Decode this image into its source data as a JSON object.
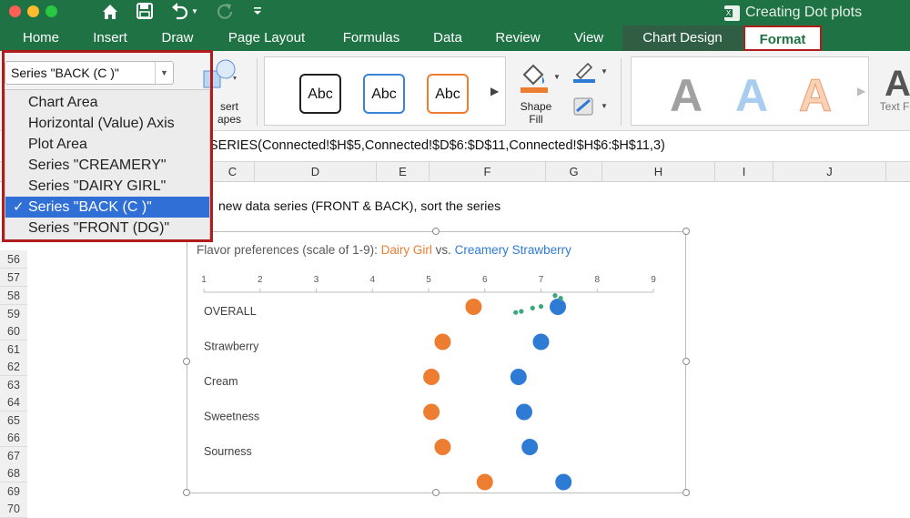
{
  "titlebar": {
    "doc_title": "Creating Dot plots",
    "colors": {
      "close": "#fe5f57",
      "minimize": "#febc2e",
      "maximize": "#28c840"
    },
    "icons": [
      "home-icon",
      "save-icon",
      "undo-icon",
      "redo-icon",
      "customize-icon"
    ]
  },
  "tabs": [
    "Home",
    "Insert",
    "Draw",
    "Page Layout",
    "Formulas",
    "Data",
    "Review",
    "View",
    "Chart Design",
    "Format"
  ],
  "ribbon": {
    "insert_shapes_label": "Insert Shapes",
    "insert_shapes_top": "sert",
    "insert_shapes_bottom": "apes",
    "shape_styles": [
      "Abc",
      "Abc",
      "Abc"
    ],
    "shape_fill_label_1": "Shape",
    "shape_fill_label_2": "Fill",
    "wordart_letters": [
      "A",
      "A",
      "A",
      "A"
    ],
    "text_fill_label": "Text F"
  },
  "formula_bar": {
    "formula": "SERIES(Connected!$H$5,Connected!$D$6:$D$11,Connected!$H$6:$H$11,3)"
  },
  "columns": [
    "C",
    "D",
    "E",
    "F",
    "G",
    "H",
    "I",
    "J"
  ],
  "rows": [
    "56",
    "57",
    "58",
    "59",
    "60",
    "61",
    "62",
    "63",
    "64",
    "65",
    "66",
    "67",
    "68",
    "69",
    "70"
  ],
  "cell_text": "new data series (FRONT & BACK), sort the series",
  "element_selector": {
    "selected": "Series \"BACK (C )\"",
    "options": [
      "Chart Area",
      "Horizontal (Value) Axis",
      "Plot Area",
      "Series \"CREAMERY\"",
      "Series \"DAIRY GIRL\"",
      "Series \"BACK (C )\"",
      "Series \"FRONT (DG)\""
    ],
    "selected_index": 5,
    "check": "✓"
  },
  "chart_data": {
    "type": "scatter",
    "title_parts": [
      {
        "text": "Flavor preferences (scale of 1-9): ",
        "color": "#595959"
      },
      {
        "text": "Dairy Girl",
        "color": "#ed7d31"
      },
      {
        "text": " vs. ",
        "color": "#595959"
      },
      {
        "text": "Creamery Strawberry",
        "color": "#2e7bd6"
      }
    ],
    "xlim": [
      1,
      9
    ],
    "xticks": [
      "1",
      "2",
      "3",
      "4",
      "5",
      "6",
      "7",
      "8",
      "9"
    ],
    "categories": [
      "OVERALL",
      "Strawberry",
      "Cream",
      "Sweetness",
      "Sourness"
    ],
    "series": [
      {
        "name": "DAIRY GIRL",
        "color": "#ed7d31",
        "values": [
          5.8,
          5.25,
          5.05,
          5.05,
          5.25,
          6.0
        ]
      },
      {
        "name": "CREAMERY",
        "color": "#2e7bd6",
        "values": [
          7.3,
          7.0,
          6.6,
          6.7,
          6.8,
          7.4
        ]
      },
      {
        "name": "BACK (C )",
        "color": "#3aa87a",
        "points": [
          [
            7.25,
            0.3
          ],
          [
            7.35,
            0.55
          ],
          [
            7.0,
            1.3
          ],
          [
            6.85,
            1.45
          ],
          [
            6.65,
            1.75
          ],
          [
            6.55,
            1.85
          ]
        ]
      }
    ],
    "grid": false
  }
}
